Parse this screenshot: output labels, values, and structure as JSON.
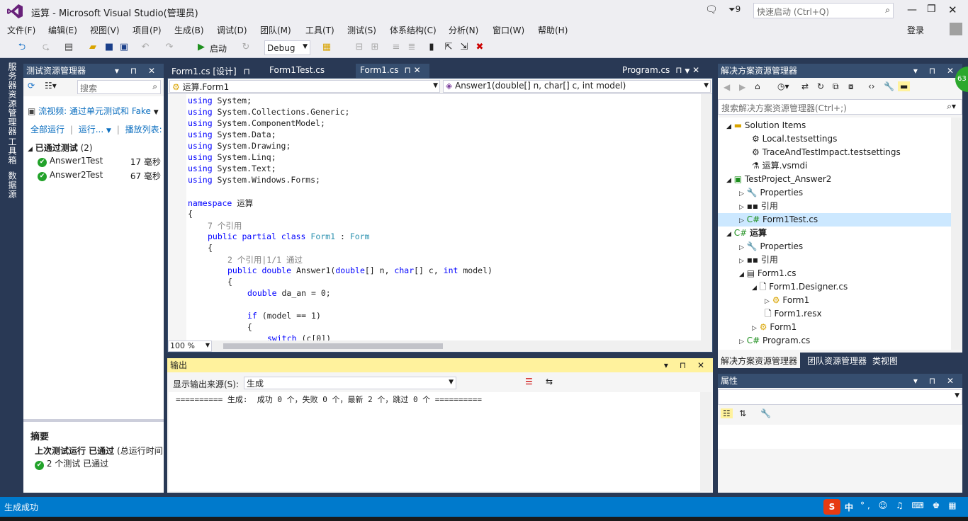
{
  "window": {
    "title": "运算 - Microsoft Visual Studio(管理员)",
    "notif_count": "9",
    "quick_launch_placeholder": "快速启动 (Ctrl+Q)",
    "login": "登录"
  },
  "menu": [
    "文件(F)",
    "编辑(E)",
    "视图(V)",
    "项目(P)",
    "生成(B)",
    "调试(D)",
    "团队(M)",
    "工具(T)",
    "测试(S)",
    "体系结构(C)",
    "分析(N)",
    "窗口(W)",
    "帮助(H)"
  ],
  "toolbar": {
    "start_label": "启动",
    "config": "Debug"
  },
  "left_tabs": [
    "服务器资源管理器",
    "工具箱",
    "数据源"
  ],
  "test_explorer": {
    "title": "测试资源管理器",
    "search_placeholder": "搜索",
    "playlist": "流视频: 通过单元测试和 Fake",
    "run_all": "全部运行",
    "run": "运行...",
    "playlist_link": "播放列表:",
    "group_title": "已通过测试",
    "group_count": "(2)",
    "tests": [
      {
        "name": "Answer1Test",
        "time": "17 毫秒"
      },
      {
        "name": "Answer2Test",
        "time": "67 毫秒"
      }
    ],
    "summary_title": "摘要",
    "last_run": "上次测试运行 已通过",
    "last_run_detail": "(总运行时间",
    "passed": "2 个测试 已通过"
  },
  "editor": {
    "tabs": [
      {
        "label": "Form1.cs [设计]"
      },
      {
        "label": "Form1Test.cs"
      },
      {
        "label": "Form1.cs"
      },
      {
        "label": "Program.cs"
      }
    ],
    "nav_left": "运算.Form1",
    "nav_right": "Answer1(double[] n, char[] c, int model)",
    "zoom": "100 %",
    "lines": [
      {
        "kw": "using",
        "rest": " System;"
      },
      {
        "kw": "using",
        "rest": " System.Collections.Generic;"
      },
      {
        "kw": "using",
        "rest": " System.ComponentModel;"
      },
      {
        "kw": "using",
        "rest": " System.Data;"
      },
      {
        "kw": "using",
        "rest": " System.Drawing;"
      },
      {
        "kw": "using",
        "rest": " System.Linq;"
      },
      {
        "kw": "using",
        "rest": " System.Text;"
      },
      {
        "kw": "using",
        "rest": " System.Windows.Forms;"
      }
    ],
    "ns_kw": "namespace",
    "ns_name": " 运算",
    "brace_open": "{",
    "ref1": "7 个引用",
    "class_kw": "public partial class",
    "class_name": " Form1",
    "colon": " : ",
    "base_name": "Form",
    "ref2": "2 个引用|1/1 通过",
    "method_kw": "public double",
    "method_rest1": " Answer1(",
    "p1_kw": "double",
    "p1_rest": "[] n, ",
    "p2_kw": "char",
    "p2_rest": "[] c, ",
    "p3_kw": "int",
    "p3_rest": " model)",
    "var_kw": "double",
    "var_rest": " da_an = 0;",
    "if_kw": "if",
    "if_rest": " (model == 1)",
    "switch_kw": "switch",
    "switch_rest": " (c[0])"
  },
  "output": {
    "title": "输出",
    "source_label": "显示输出来源(S):",
    "source_value": "生成",
    "text": "========== 生成:  成功 0 个，失败 0 个，最新 2 个，跳过 0 个 =========="
  },
  "solution": {
    "title": "解决方案资源管理器",
    "search_placeholder": "搜索解决方案资源管理器(Ctrl+;)",
    "items": [
      {
        "label": "Solution Items",
        "indent": 0
      },
      {
        "label": "Local.testsettings",
        "indent": 1
      },
      {
        "label": "TraceAndTestImpact.testsettings",
        "indent": 1
      },
      {
        "label": "运算.vsmdi",
        "indent": 1
      },
      {
        "label": "TestProject_Answer2",
        "indent": 0
      },
      {
        "label": "Properties",
        "indent": 1
      },
      {
        "label": "引用",
        "indent": 1
      },
      {
        "label": "Form1Test.cs",
        "indent": 1
      },
      {
        "label": "运算",
        "indent": 0
      },
      {
        "label": "Properties",
        "indent": 1
      },
      {
        "label": "引用",
        "indent": 1
      },
      {
        "label": "Form1.cs",
        "indent": 1
      },
      {
        "label": "Form1.Designer.cs",
        "indent": 2
      },
      {
        "label": "Form1",
        "indent": 3
      },
      {
        "label": "Form1.resx",
        "indent": 2
      },
      {
        "label": "Form1",
        "indent": 2
      },
      {
        "label": "Program.cs",
        "indent": 1
      }
    ],
    "bottom_tabs": [
      "解决方案资源管理器",
      "团队资源管理器",
      "类视图"
    ],
    "badge": "63"
  },
  "properties": {
    "title": "属性"
  },
  "status": {
    "text": "生成成功",
    "ime": "中"
  }
}
